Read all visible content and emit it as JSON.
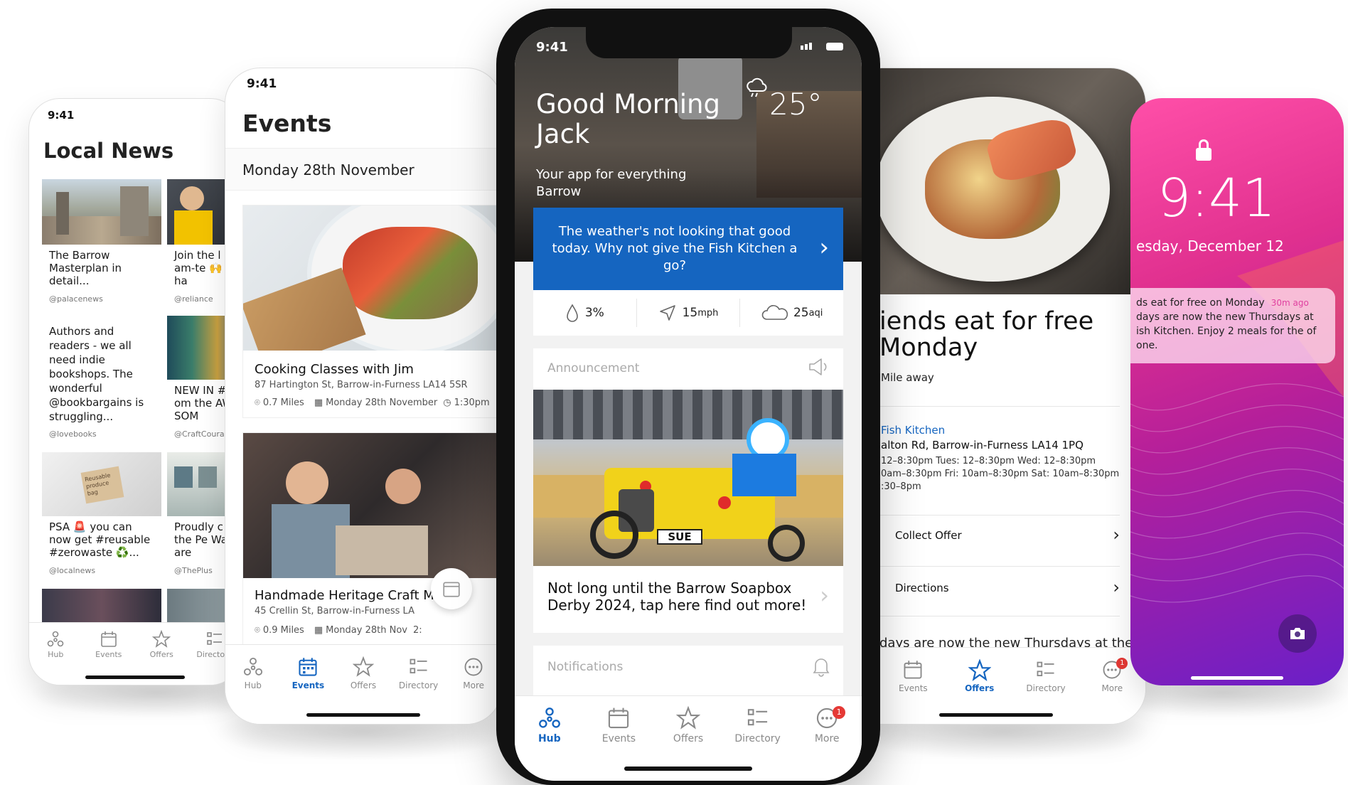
{
  "status_time": "9:41",
  "nav": {
    "hub": "Hub",
    "events": "Events",
    "offers": "Offers",
    "directory": "Directory",
    "more": "More",
    "badge": "1"
  },
  "news": {
    "title": "Local News",
    "cards": [
      {
        "text": "The Barrow Masterplan in detail...",
        "handle": "@palacenews"
      },
      {
        "text": "Join the l dream-te 🙌 We ha",
        "handle": "@reliance"
      },
      {
        "text": "Authors and readers - we all need indie bookshops. The wonderful @bookbargains is struggling...",
        "handle": "@lovebooks"
      },
      {
        "text": "NEW IN # from the AWESOM",
        "handle": "@CraftCoura"
      },
      {
        "text": "PSA 🚨 you can now get #reusable #zerowaste ♻️...",
        "handle": "@localnews"
      },
      {
        "text": "Proudly c on the Pe Wall are ",
        "handle": "@ThePlus"
      }
    ],
    "bag_text": "Reusable produce bag"
  },
  "events": {
    "title": "Events",
    "date": "Monday 28th November",
    "items": [
      {
        "title": "Cooking Classes with Jim",
        "address": "87 Hartington St, Barrow-in-Furness LA14 5SR",
        "distance": "0.7 Miles",
        "date": "Monday 28th November",
        "time": "1:30pm"
      },
      {
        "title": "Handmade Heritage Craft Market",
        "address": "45 Crellin St, Barrow-in-Furness LA",
        "distance": "0.9 Miles",
        "date": "Monday 28th Nov",
        "time": "2:"
      }
    ]
  },
  "hub": {
    "greeting": "Good Morning Jack",
    "subtitle": "Your app for everything Barrow",
    "temp": "25°",
    "banner": "The weather's not looking that good today. Why not give the Fish Kitchen a go?",
    "rain": "3%",
    "wind_value": "15",
    "wind_unit": "mph",
    "aqi_value": "25",
    "aqi_unit": "aqi",
    "announcement_label": "Announcement",
    "plate_text": "SUE",
    "announcement_text": "Not long until the Barrow Soapbox Derby 2024, tap here find out more!",
    "notifications_label": "Notifications"
  },
  "offer": {
    "title": "iends eat for free Monday",
    "distance": "Mile away",
    "venue": "Fish Kitchen",
    "address": "alton Rd, Barrow-in-Furness LA14 1PQ",
    "hours_1": "12–8:30pm  Tues: 12–8:30pm  Wed: 12–8:30pm",
    "hours_2": "0am–8:30pm  Fri: 10am–8:30pm  Sat: 10am–8:30pm",
    "hours_3": ":30–8pm",
    "collect": "Collect Offer",
    "directions": "Directions",
    "footer_text": "days are now the new Thursdays at the"
  },
  "lock": {
    "time": "9:41",
    "date": "esday, December 12",
    "notif_title": "ds eat for free on Monday",
    "notif_ago": "30m ago",
    "notif_body": "days are now the new Thursdays at ish Kitchen. Enjoy 2 meals for the of one."
  },
  "colors": {
    "primary_blue": "#1565c0",
    "banner_blue": "#1565c0",
    "badge_red": "#e53935",
    "lock_pink": "#e040a0",
    "lock_purple": "#7b2ff7"
  }
}
